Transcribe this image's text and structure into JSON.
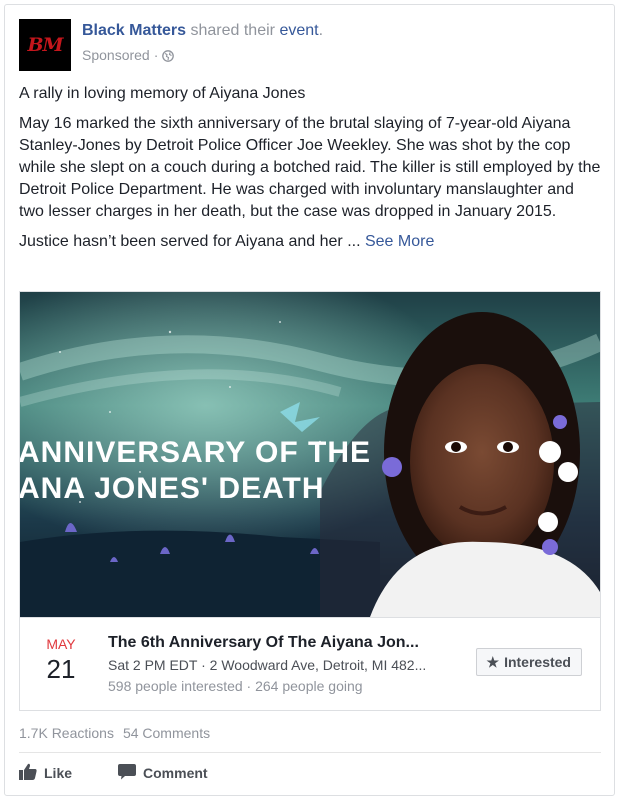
{
  "post": {
    "avatar_text": "BM",
    "page_name": "Black Matters",
    "shared_text": " shared their ",
    "event_word": "event",
    "period": ".",
    "sponsored": "Sponsored",
    "dot": "·",
    "paragraphs": [
      "A rally in loving memory of Aiyana Jones",
      "May 16 marked the sixth anniversary of the brutal slaying of 7-year-old Aiyana Stanley-Jones by Detroit Police Officer Joe Weekley. She was shot by the cop while she slept on a couch during a botched raid. The killer is still employed by the Detroit Police Department. He was charged with involuntary manslaughter and two lesser charges in her death, but the case was dropped in January 2015."
    ],
    "truncated": "Justice hasn’t been served for Aiyana and her ... ",
    "see_more": "See More"
  },
  "event": {
    "banner_line1": "ANNIVERSARY OF THE",
    "banner_line2": "ANA JONES' DEATH",
    "month": "MAY",
    "day": "21",
    "title": "The 6th Anniversary Of The Aiyana Jon...",
    "when_where": "Sat 2 PM EDT · 2 Woodward Ave, Detroit, MI 482...",
    "stats": "598 people interested · 264 people going",
    "interested_label": "Interested",
    "star": "★"
  },
  "footer": {
    "reactions": "1.7K Reactions",
    "comments": "54 Comments",
    "like": "Like",
    "comment": "Comment"
  },
  "colors": {
    "link": "#365899",
    "month": "#e0393e",
    "avatar_bg": "#000000",
    "avatar_text": "#c4161c"
  }
}
